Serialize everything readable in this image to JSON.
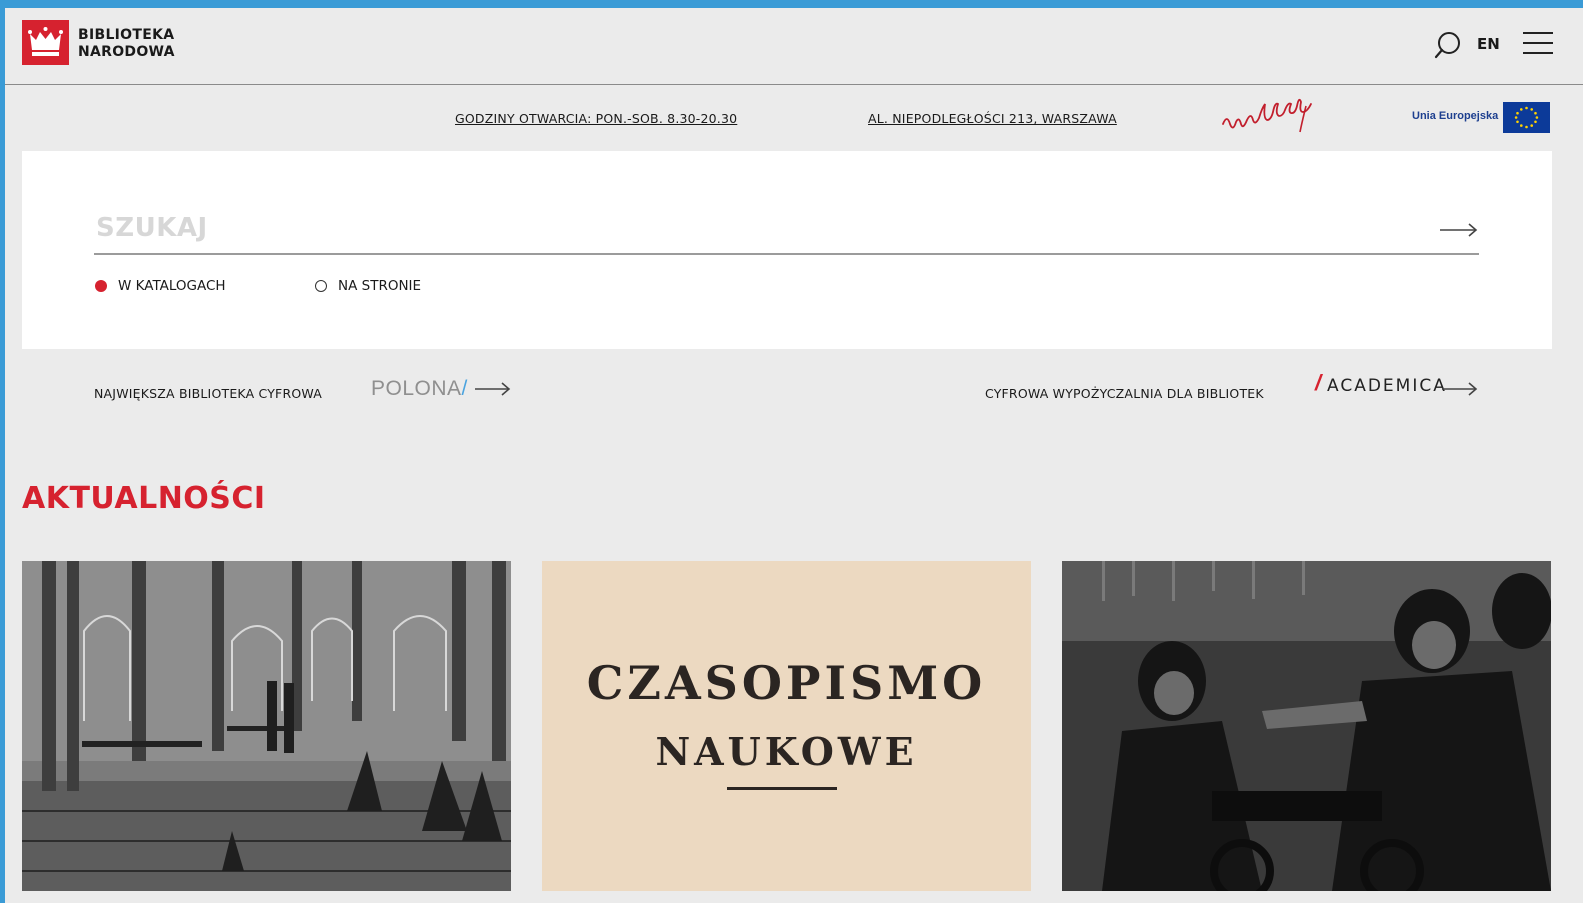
{
  "header": {
    "logo_line1": "BIBLIOTEKA",
    "logo_line2": "NARODOWA",
    "lang": "EN"
  },
  "info": {
    "hours": "GODZINY OTWARCIA:  PON.-SOB. 8.30-20.30",
    "address": "AL. NIEPODLEGŁOŚCI 213, WARSZAWA",
    "eu_label": "Unia Europejska"
  },
  "search": {
    "placeholder": "SZUKAJ",
    "options": [
      {
        "label": "W KATALOGACH",
        "selected": true
      },
      {
        "label": "NA STRONIE",
        "selected": false
      }
    ]
  },
  "promos": {
    "polona_label": "NAJWIĘKSZA BIBLIOTEKA CYFROWA",
    "polona_word": "POLONA",
    "polona_slash": "/",
    "academica_label": "CYFROWA WYPOŻYCZALNIA DLA BIBLIOTEK",
    "academica_slash": "/",
    "academica_word": "ACADEMICA"
  },
  "news": {
    "title": "AKTUALNOŚCI",
    "card2_line1": "CZASOPISMO",
    "card2_line2": "NAUKOWE"
  },
  "colors": {
    "brand_red": "#d6222f",
    "eu_blue": "#0c3a99",
    "background": "#ebebeb"
  },
  "icons": [
    "crown-logo-icon",
    "search-icon",
    "menu-icon",
    "arrow-right-icon",
    "eu-flag-icon"
  ]
}
